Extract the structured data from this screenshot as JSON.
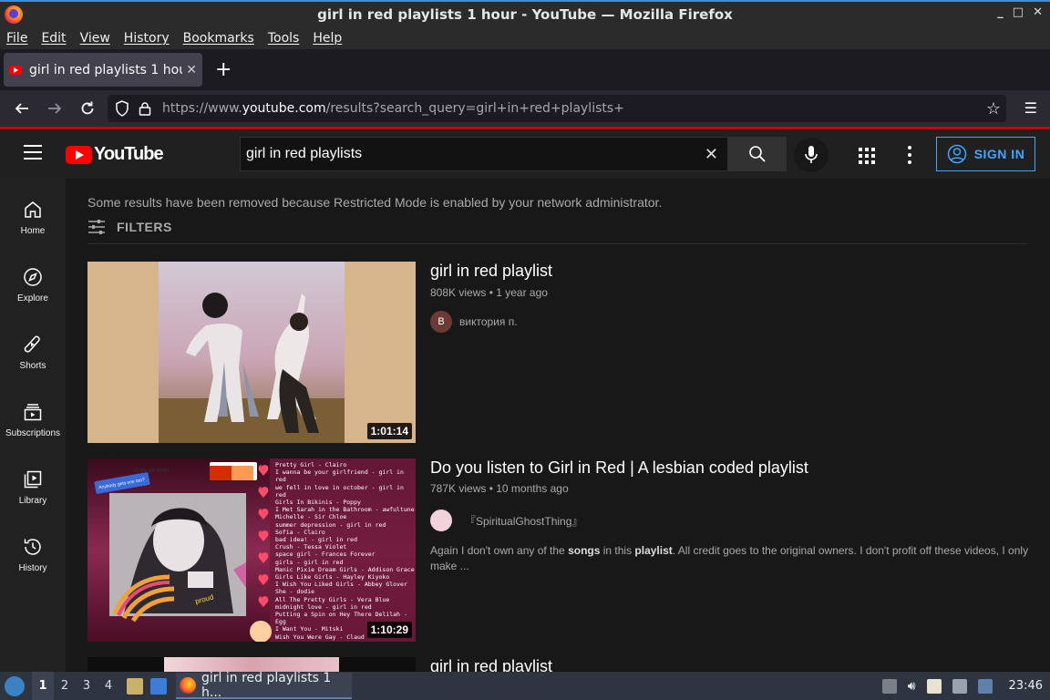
{
  "window": {
    "title": "girl in red playlists 1 hour - YouTube — Mozilla Firefox",
    "controls": [
      "_",
      "□",
      "✕"
    ]
  },
  "menubar": [
    "File",
    "Edit",
    "View",
    "History",
    "Bookmarks",
    "Tools",
    "Help"
  ],
  "tab": {
    "title": "girl in red playlists 1 hour",
    "close": "✕",
    "new": "+"
  },
  "nav": {
    "url_prefix": "https://www.",
    "url_domain": "youtube.com",
    "url_path": "/results?search_query=girl+in+red+playlists+"
  },
  "youtube": {
    "logo_text": "YouTube",
    "search_value": "girl in red playlists",
    "signin": "SIGN IN",
    "sidebar": [
      {
        "label": "Home",
        "icon": "home-icon"
      },
      {
        "label": "Explore",
        "icon": "compass-icon"
      },
      {
        "label": "Shorts",
        "icon": "shorts-icon"
      },
      {
        "label": "Subscriptions",
        "icon": "subscriptions-icon"
      },
      {
        "label": "Library",
        "icon": "library-icon"
      },
      {
        "label": "History",
        "icon": "history-icon"
      }
    ],
    "notice": "Some results have been removed because Restricted Mode is enabled by your network administrator.",
    "filters": "FILTERS",
    "results": [
      {
        "title": "girl in red playlist",
        "views": "808K views",
        "age": "1 year ago",
        "channel": "виктория п.",
        "avatar_letter": "В",
        "duration": "1:01:14"
      },
      {
        "title": "Do you listen to Girl in Red | A lesbian coded playlist",
        "views": "787K views",
        "age": "10 months ago",
        "channel": "『SpiritualGhostThing』",
        "duration": "1:10:29",
        "desc_1": "Again I don't own any of the ",
        "desc_b1": "songs",
        "desc_2": " in this ",
        "desc_b2": "playlist",
        "desc_3": ". All credit goes to the original owners. I don't profit off these videos, I only make ...",
        "thumb_tracks": [
          "Pretty Girl - Clairo",
          "I wanna be your girlfriend - girl in",
          "red",
          "we fell in love in october - girl in",
          "red",
          "Girls In Bikinis - Poppy",
          "I Met Sarah in the Bathroom - awfultune",
          "Michelle - Sir Chloe",
          "summer depression - girl in red",
          "Sofia - Clairo",
          "bad idea! - girl in red",
          "Crush - Tessa Violet",
          "space girl - Frances Forever",
          "girls - girl in red",
          "Manic Pixie Dream Girls - Addison Grace",
          "Girls Like Girls - Hayley Kiyoko",
          "I Wish You Liked Girls - Abbey Glover",
          "She - dodie",
          "All The Pretty Girls - Vera Blue",
          "midnight love - girl in red",
          "Putting a Spin on Hey There Delilah -",
          "Egg",
          "I Want You - Mitski",
          "Wish You Were Gay - Claud"
        ],
        "thumb_sticker_1": "Gay as ever",
        "thumb_sticker_2": "Anybody gets one too?",
        "thumb_sticker_3": "proud"
      },
      {
        "title": "girl in red playlist"
      }
    ]
  },
  "taskbar": {
    "workspaces": [
      "1",
      "2",
      "3",
      "4"
    ],
    "task_label": "girl in red playlists 1 h...",
    "clock": "23:46"
  },
  "colors": {
    "yt_red": "#ff0000",
    "accent_blue": "#3ea6ff",
    "firefox_accent": "#3a8ee6"
  }
}
